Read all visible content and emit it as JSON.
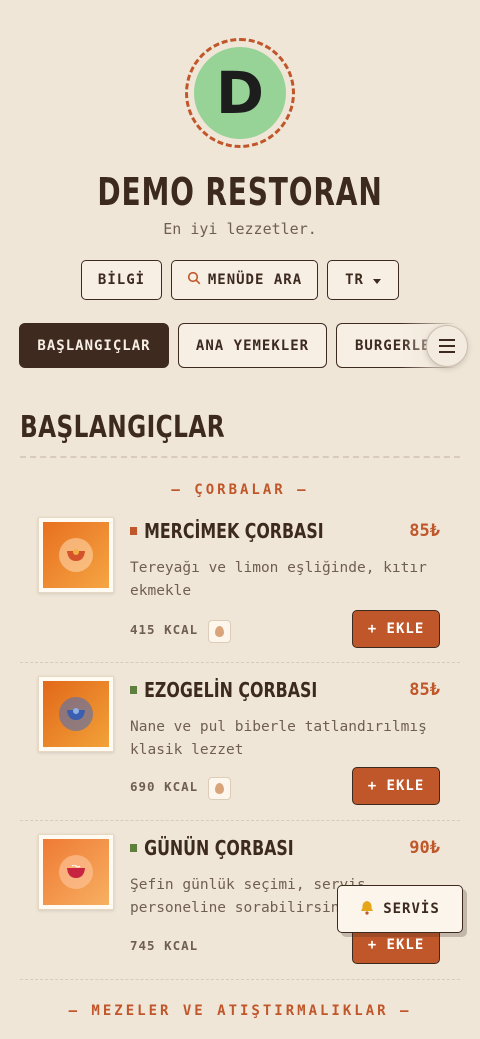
{
  "brand": {
    "logo_letter": "D",
    "name": "DEMO RESTORAN",
    "tagline": "En iyi lezzetler."
  },
  "toolbar": {
    "info_label": "BİLGİ",
    "search_label": "MENÜDE ARA",
    "language_label": "TR"
  },
  "tabs": [
    {
      "label": "BAŞLANGIÇLAR",
      "active": true
    },
    {
      "label": "ANA YEMEKLER",
      "active": false
    },
    {
      "label": "BURGERLER",
      "active": false
    }
  ],
  "section": {
    "title": "BAŞLANGIÇLAR",
    "categories": [
      "— ÇORBALAR —",
      "— MEZELER VE ATIŞTIRMALIKLAR —"
    ]
  },
  "items": [
    {
      "name": "MERCİMEK ÇORBASI",
      "price": "85₺",
      "description": "Tereyağı ve limon eşliğinde, kıtır ekmekle",
      "kcal": "415 KCAL",
      "marker_color": "#c0572a",
      "add_label": "+ EKLE",
      "has_allergen": true
    },
    {
      "name": "EZOGELİN ÇORBASI",
      "price": "85₺",
      "description": "Nane ve pul biberle tatlandırılmış klasik lezzet",
      "kcal": "690 KCAL",
      "marker_color": "#5f7f3f",
      "add_label": "+ EKLE",
      "has_allergen": true
    },
    {
      "name": "GÜNÜN ÇORBASI",
      "price": "90₺",
      "description": "Şefin günlük seçimi, servis personeline sorabilirsiniz.",
      "kcal": "745 KCAL",
      "marker_color": "#5f7f3f",
      "add_label": "+ EKLE",
      "has_allergen": false
    }
  ],
  "service_button": {
    "label": "SERVİS",
    "icon": "bell-icon"
  },
  "colors": {
    "background": "#f0e6d8",
    "accent": "#c0572a",
    "dark": "#3f2a20",
    "logo_bg": "#97d296"
  }
}
